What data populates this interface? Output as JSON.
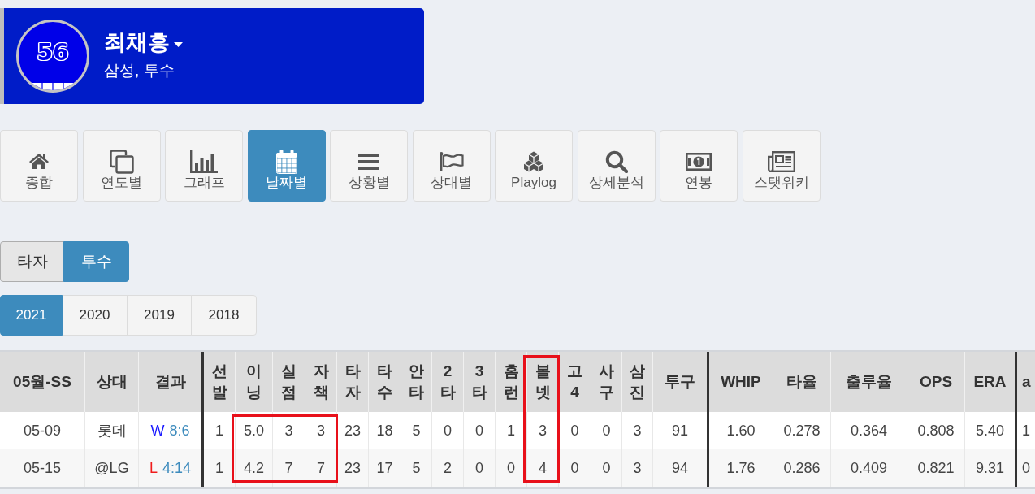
{
  "player": {
    "number": "56",
    "name": "최채흥",
    "info": "삼성, 투수"
  },
  "nav": [
    {
      "label": "종합",
      "selected": false
    },
    {
      "label": "연도별",
      "selected": false
    },
    {
      "label": "그래프",
      "selected": false
    },
    {
      "label": "날짜별",
      "selected": true
    },
    {
      "label": "상황별",
      "selected": false
    },
    {
      "label": "상대별",
      "selected": false
    },
    {
      "label": "Playlog",
      "selected": false
    },
    {
      "label": "상세분석",
      "selected": false
    },
    {
      "label": "연봉",
      "selected": false
    },
    {
      "label": "스탯위키",
      "selected": false
    }
  ],
  "role_toggle": [
    {
      "label": "타자",
      "selected": false
    },
    {
      "label": "투수",
      "selected": true
    }
  ],
  "years": [
    {
      "label": "2021",
      "selected": true
    },
    {
      "label": "2020",
      "selected": false
    },
    {
      "label": "2019",
      "selected": false
    },
    {
      "label": "2018",
      "selected": false
    }
  ],
  "table": {
    "column_groups": [
      {
        "columns": [
          {
            "label": "05월-SS",
            "highlighted": false
          },
          {
            "label": "상대",
            "highlighted": false
          },
          {
            "label": "결과",
            "highlighted": false
          }
        ]
      },
      {
        "columns": [
          {
            "label": "선발",
            "highlighted": false
          },
          {
            "label": "이닝",
            "highlighted": true,
            "header_highlighted": false
          },
          {
            "label": "실점",
            "highlighted": true,
            "header_highlighted": false
          },
          {
            "label": "자책",
            "highlighted": true,
            "header_highlighted": false
          },
          {
            "label": "타자",
            "highlighted": false
          },
          {
            "label": "타수",
            "highlighted": false
          },
          {
            "label": "안타",
            "highlighted": false
          },
          {
            "label": "2타",
            "highlighted": false
          },
          {
            "label": "3타",
            "highlighted": false
          },
          {
            "label": "홈런",
            "highlighted": false
          },
          {
            "label": "볼넷",
            "highlighted": true,
            "header_highlighted": true
          },
          {
            "label": "고4",
            "highlighted": false
          },
          {
            "label": "사구",
            "highlighted": false
          },
          {
            "label": "삼진",
            "highlighted": false
          },
          {
            "label": "투구",
            "highlighted": false
          }
        ]
      },
      {
        "columns": [
          {
            "label": "WHIP",
            "highlighted": false
          },
          {
            "label": "타율",
            "highlighted": false
          },
          {
            "label": "출루율",
            "highlighted": false
          },
          {
            "label": "OPS",
            "highlighted": false
          },
          {
            "label": "ERA",
            "highlighted": false
          }
        ]
      },
      {
        "columns": [
          {
            "label": "a",
            "highlighted": false
          }
        ]
      }
    ],
    "rows": [
      {
        "cells": [
          "05-09",
          "롯데",
          {
            "outcome": "W",
            "score": "8:6",
            "kind": "win"
          },
          "1",
          "5.0",
          "3",
          "3",
          "23",
          "18",
          "5",
          "0",
          "0",
          "1",
          "3",
          "0",
          "0",
          "3",
          "91",
          "1.60",
          "0.278",
          "0.364",
          "0.808",
          "5.40",
          "1"
        ]
      },
      {
        "cells": [
          "05-15",
          "@LG",
          {
            "outcome": "L",
            "score": "4:14",
            "kind": "loss"
          },
          "1",
          "4.2",
          "7",
          "7",
          "23",
          "17",
          "5",
          "2",
          "0",
          "0",
          "4",
          "0",
          "0",
          "3",
          "94",
          "1.76",
          "0.286",
          "0.409",
          "0.821",
          "9.31",
          "0"
        ]
      }
    ]
  }
}
